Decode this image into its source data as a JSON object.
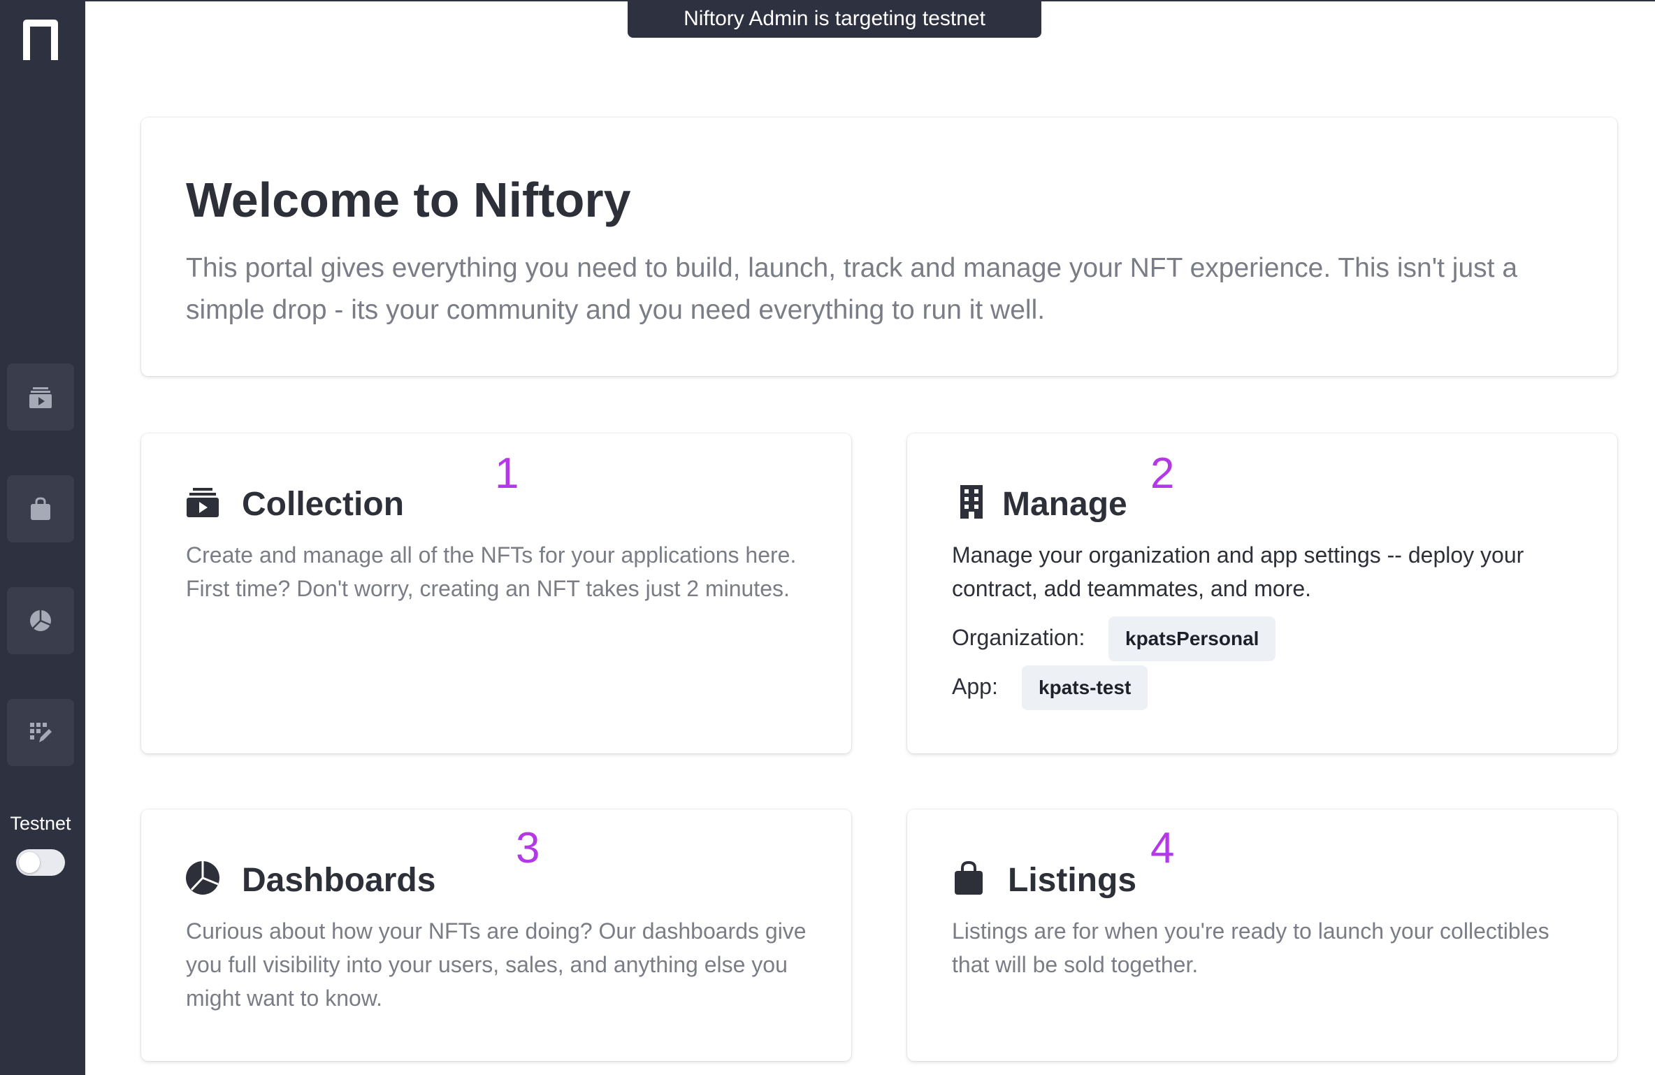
{
  "banner": {
    "text": "Niftory Admin is targeting testnet"
  },
  "sidebar": {
    "logo_icon": "niftory-n-logo",
    "items": [
      {
        "name": "collection",
        "icon": "collection-icon"
      },
      {
        "name": "listings",
        "icon": "shopping-bag-icon"
      },
      {
        "name": "dashboards",
        "icon": "pie-chart-icon"
      },
      {
        "name": "manage",
        "icon": "grid-edit-icon"
      }
    ],
    "network_label": "Testnet",
    "network_toggle_on": false
  },
  "hero": {
    "title": "Welcome to Niftory",
    "description": "This portal gives everything you need to build, launch, track and manage your NFT experience. This isn't just a simple drop - its your community and you need everything to run it well."
  },
  "cards": {
    "collection": {
      "number": "1",
      "title": "Collection",
      "icon": "collection-icon",
      "description": "Create and manage all of the NFTs for your applications here. First time? Don't worry, creating an NFT takes just 2 minutes."
    },
    "manage": {
      "number": "2",
      "title": "Manage",
      "icon": "building-icon",
      "description": "Manage your organization and app settings -- deploy your contract, add teammates, and more.",
      "organization_label": "Organization:",
      "organization_value": "kpatsPersonal",
      "app_label": "App:",
      "app_value": "kpats-test"
    },
    "dashboards": {
      "number": "3",
      "title": "Dashboards",
      "icon": "pie-chart-icon",
      "description": "Curious about how your NFTs are doing? Our dashboards give you full visibility into your users, sales, and anything else you might want to know."
    },
    "listings": {
      "number": "4",
      "title": "Listings",
      "icon": "shopping-bag-icon",
      "description": "Listings are for when you're ready to launch your collectibles that will be sold together."
    }
  },
  "colors": {
    "sidebar_bg": "#2e3140",
    "accent_number": "#b339e6",
    "pill_bg": "#edf0f5"
  }
}
